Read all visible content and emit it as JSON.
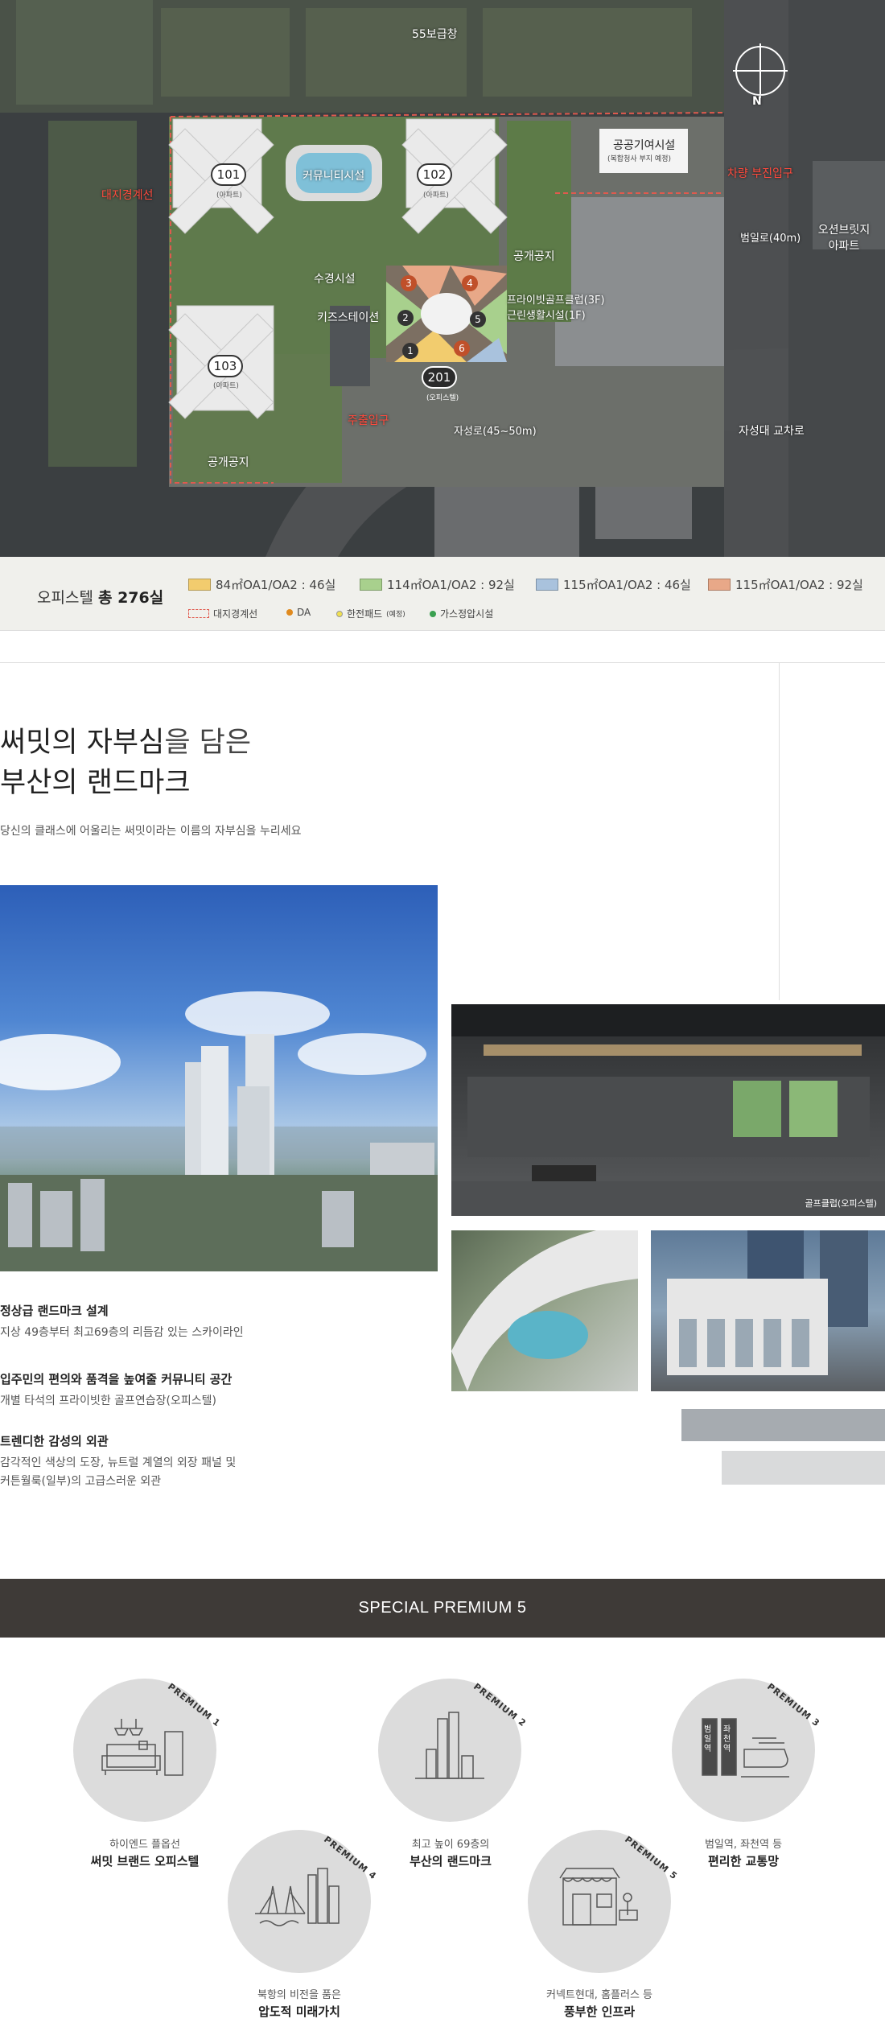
{
  "site_plan": {
    "labels": {
      "reserve": "55보급창",
      "boundary": "대지경계선",
      "community": "커뮤니티시설",
      "bldg_101": "101",
      "bldg_102": "102",
      "bldg_103": "103",
      "bldg_201": "201",
      "bldg_sub_101": "(아파트)",
      "bldg_sub_102": "(아파트)",
      "bldg_sub_103": "(아파트)",
      "bldg_sub_201": "(오피스텔)",
      "waterscape": "수경시설",
      "kids": "키즈스테이션",
      "pedestrian_entrance": "주출입구",
      "public_space": "공개공지",
      "public_space2": "공개공지",
      "private_golf": "프라이빗골프클럽(3F)",
      "retail": "근린생활시설(1F)",
      "public_facility": "공공기여시설",
      "public_facility_sub": "(복합청사 부지 예정)",
      "vehicle_entrance": "차량 부진입구",
      "beomil_ro": "범일로(40m)",
      "jaseong_ro": "자성로(45~50m)",
      "intersection": "자성대 교차로",
      "apartment": "오션브릿지 아파트",
      "north": "N"
    },
    "unit_numbers": [
      "1",
      "2",
      "3",
      "4",
      "5",
      "6"
    ]
  },
  "legend": {
    "title_prefix": "오피스텔",
    "title_bold": "총 276실",
    "types": [
      {
        "label": "84㎡OA1/OA2 : 46실",
        "color": "#f2cc6e"
      },
      {
        "label": "114㎡OA1/OA2 : 92실",
        "color": "#a8d08d"
      },
      {
        "label": "115㎡OA1/OA2 : 46실",
        "color": "#a9c2dd"
      },
      {
        "label": "115㎡OA1/OA2 : 92실",
        "color": "#e8a888"
      }
    ],
    "marks": [
      {
        "label": "대지경계선",
        "color": "#e05a4e"
      },
      {
        "label": "DA",
        "color": "#e08a1e"
      },
      {
        "label": "한전패드",
        "sub": "(예정)",
        "color": "#f0e050"
      },
      {
        "label": "가스정압시설",
        "color": "#3aa050"
      }
    ]
  },
  "intro": {
    "headline_1_bold": "써밋의 자부심",
    "headline_1_rest": "을 담은",
    "headline_2": "부산의 랜드마크",
    "subtitle": "당신의 클래스에 어울리는 써밋이라는 이름의 자부심을 누리세요"
  },
  "photos": {
    "golf_caption": "골프클럽(오피스텔)"
  },
  "features": [
    {
      "title": "정상급 랜드마크 설계",
      "desc": "지상 49층부터 최고69층의 리듬감 있는 스카이라인"
    },
    {
      "title": "입주민의 편의와 품격을 높여줄 커뮤니티 공간",
      "desc": "개별 타석의 프라이빗한 골프연습장(오피스텔)"
    },
    {
      "title": "트렌디한 감성의 외관",
      "desc_1": "감각적인 색상의 도장, 뉴트럴 계열의 외장 패널 및",
      "desc_2": "커튼월룩(일부)의 고급스러운 외관"
    }
  ],
  "premium": {
    "header": "SPECIAL PREMIUM 5",
    "items": [
      {
        "tag": "PREMIUM 1",
        "line1": "하이엔드 플옵선",
        "line2": "써밋 브랜드 오피스텔",
        "icon": "sofa-icon"
      },
      {
        "tag": "PREMIUM 2",
        "line1": "최고 높이 69층의",
        "line2": "부산의 랜드마크",
        "icon": "skyline-icon"
      },
      {
        "tag": "PREMIUM 3",
        "line1": "범일역, 좌천역 등",
        "line2": "편리한 교통망",
        "icon": "train-icon",
        "station1": "범일역",
        "station2": "좌천역"
      },
      {
        "tag": "PREMIUM 4",
        "line1": "북항의 비전을 품은",
        "line2": "압도적 미래가치",
        "icon": "bridge-icon"
      },
      {
        "tag": "PREMIUM 5",
        "line1": "커넥트현대, 홈플러스 등",
        "line2": "풍부한 인프라",
        "icon": "store-icon"
      }
    ]
  }
}
